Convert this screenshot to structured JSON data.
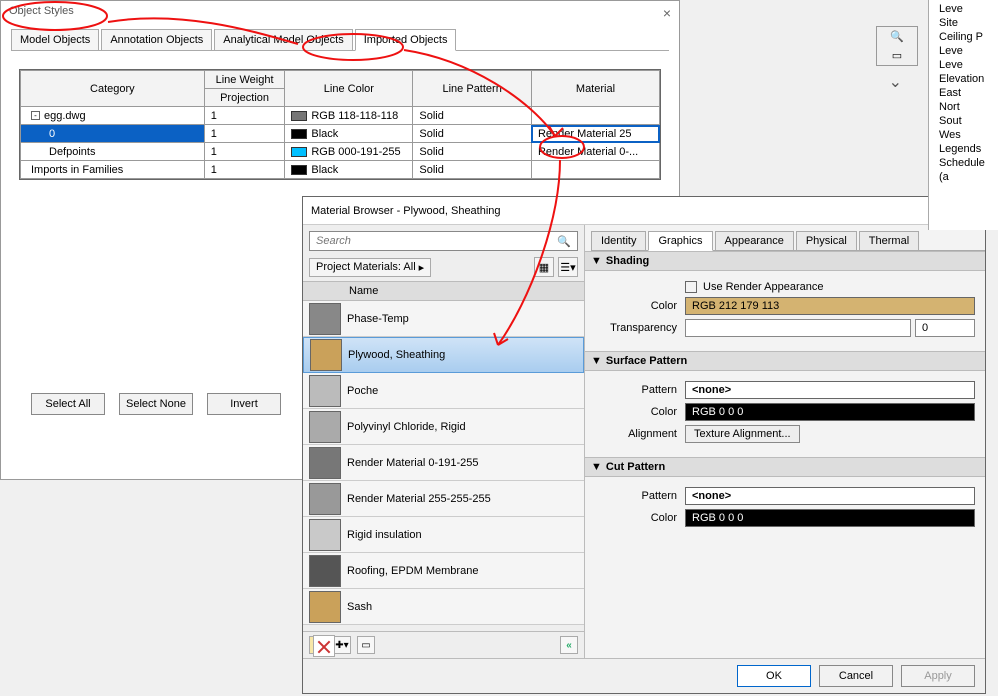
{
  "objStyles": {
    "title": "Object Styles",
    "tabs": [
      "Model Objects",
      "Annotation Objects",
      "Analytical Model Objects",
      "Imported Objects"
    ],
    "activeTab": 3,
    "headers": {
      "category": "Category",
      "lineWeight": "Line Weight",
      "projection": "Projection",
      "lineColor": "Line Color",
      "linePattern": "Line Pattern",
      "material": "Material"
    },
    "rows": [
      {
        "indent": 0,
        "toggle": "-",
        "name": "egg.dwg",
        "proj": "1",
        "color": "RGB 118-118-118",
        "swatch": "#767676",
        "pattern": "Solid",
        "material": ""
      },
      {
        "indent": 1,
        "name": "0",
        "proj": "1",
        "color": "Black",
        "swatch": "#000000",
        "pattern": "Solid",
        "material": "Render Material 25",
        "selected": true
      },
      {
        "indent": 1,
        "name": "Defpoints",
        "proj": "1",
        "color": "RGB 000-191-255",
        "swatch": "#00bfff",
        "pattern": "Solid",
        "material": "Render Material 0-..."
      },
      {
        "indent": 0,
        "name": "Imports in Families",
        "proj": "1",
        "color": "Black",
        "swatch": "#000000",
        "pattern": "Solid",
        "material": ""
      }
    ],
    "buttons": {
      "selectAll": "Select All",
      "selectNone": "Select None",
      "invert": "Invert"
    }
  },
  "matBrowser": {
    "title": "Material Browser - Plywood, Sheathing",
    "searchPlaceholder": "Search",
    "filterLabel": "Project Materials: All",
    "listHeader": "Name",
    "materials": [
      {
        "name": "Phase-Temp",
        "thumb": "#888"
      },
      {
        "name": "Plywood, Sheathing",
        "thumb": "#caa15a",
        "selected": true
      },
      {
        "name": "Poche",
        "thumb": "#bbb"
      },
      {
        "name": "Polyvinyl Chloride, Rigid",
        "thumb": "#aaa"
      },
      {
        "name": "Render Material 0-191-255",
        "thumb": "#777"
      },
      {
        "name": "Render Material 255-255-255",
        "thumb": "#999"
      },
      {
        "name": "Rigid insulation",
        "thumb": "#c9c9c9"
      },
      {
        "name": "Roofing, EPDM Membrane",
        "thumb": "#555"
      },
      {
        "name": "Sash",
        "thumb": "#caa15a"
      }
    ],
    "rightTabs": [
      "Identity",
      "Graphics",
      "Appearance",
      "Physical",
      "Thermal"
    ],
    "activeRightTab": 1,
    "shading": {
      "title": "Shading",
      "useRender": "Use Render Appearance",
      "colorLabel": "Color",
      "color": "RGB 212 179 113",
      "transparencyLabel": "Transparency",
      "transparency": "0"
    },
    "surface": {
      "title": "Surface Pattern",
      "patternLabel": "Pattern",
      "pattern": "<none>",
      "colorLabel": "Color",
      "color": "RGB 0 0 0",
      "alignLabel": "Alignment",
      "align": "Texture Alignment..."
    },
    "cut": {
      "title": "Cut Pattern",
      "patternLabel": "Pattern",
      "pattern": "<none>",
      "colorLabel": "Color",
      "color": "RGB 0 0 0"
    },
    "footer": {
      "ok": "OK",
      "cancel": "Cancel",
      "apply": "Apply"
    }
  },
  "projTree": [
    "Leve",
    "Site",
    "Ceiling P",
    "Leve",
    "Leve",
    "Elevation",
    "East",
    "Nort",
    "Sout",
    "Wes",
    "Legends",
    "Schedule",
    "(a"
  ],
  "chart_data": null
}
